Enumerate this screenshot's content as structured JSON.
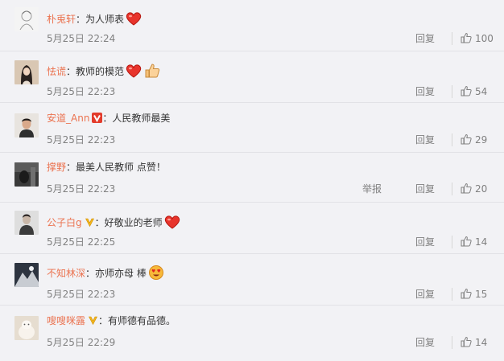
{
  "comments": [
    {
      "user": "朴兎轩",
      "text": "：为人师表",
      "time": "5月25日 22:24",
      "reply": "回复",
      "likes": "100",
      "emoji": [
        "heart"
      ],
      "badge": ""
    },
    {
      "user": "怯谎",
      "text": "：教师的模范",
      "time": "5月25日 22:23",
      "reply": "回复",
      "likes": "54",
      "emoji": [
        "heart",
        "thumb"
      ],
      "badge": ""
    },
    {
      "user": "安道_Ann",
      "text": "：人民教师最美",
      "time": "5月25日 22:23",
      "reply": "回复",
      "likes": "29",
      "emoji": [],
      "badge": "red-v"
    },
    {
      "user": "撑野",
      "text": "：最美人民教师 点赞！",
      "time": "5月25日 22:23",
      "report": "举报",
      "reply": "回复",
      "likes": "20",
      "emoji": [],
      "badge": ""
    },
    {
      "user": "公子白g",
      "text": "：好敬业的老师",
      "time": "5月25日 22:25",
      "reply": "回复",
      "likes": "14",
      "emoji": [
        "heart"
      ],
      "badge": "gold-v"
    },
    {
      "user": "不知林深",
      "text": "：亦师亦母 棒",
      "time": "5月25日 22:23",
      "reply": "回复",
      "likes": "15",
      "emoji": [
        "love-face"
      ],
      "badge": ""
    },
    {
      "user": "嗖嗖咪露",
      "text": "：有师德有品德。",
      "time": "5月25日 22:29",
      "reply": "回复",
      "likes": "14",
      "emoji": [],
      "badge": "gold-v"
    }
  ],
  "colors": {
    "username": "#eb7350",
    "meta": "#808080",
    "background": "#f2f2f5"
  }
}
